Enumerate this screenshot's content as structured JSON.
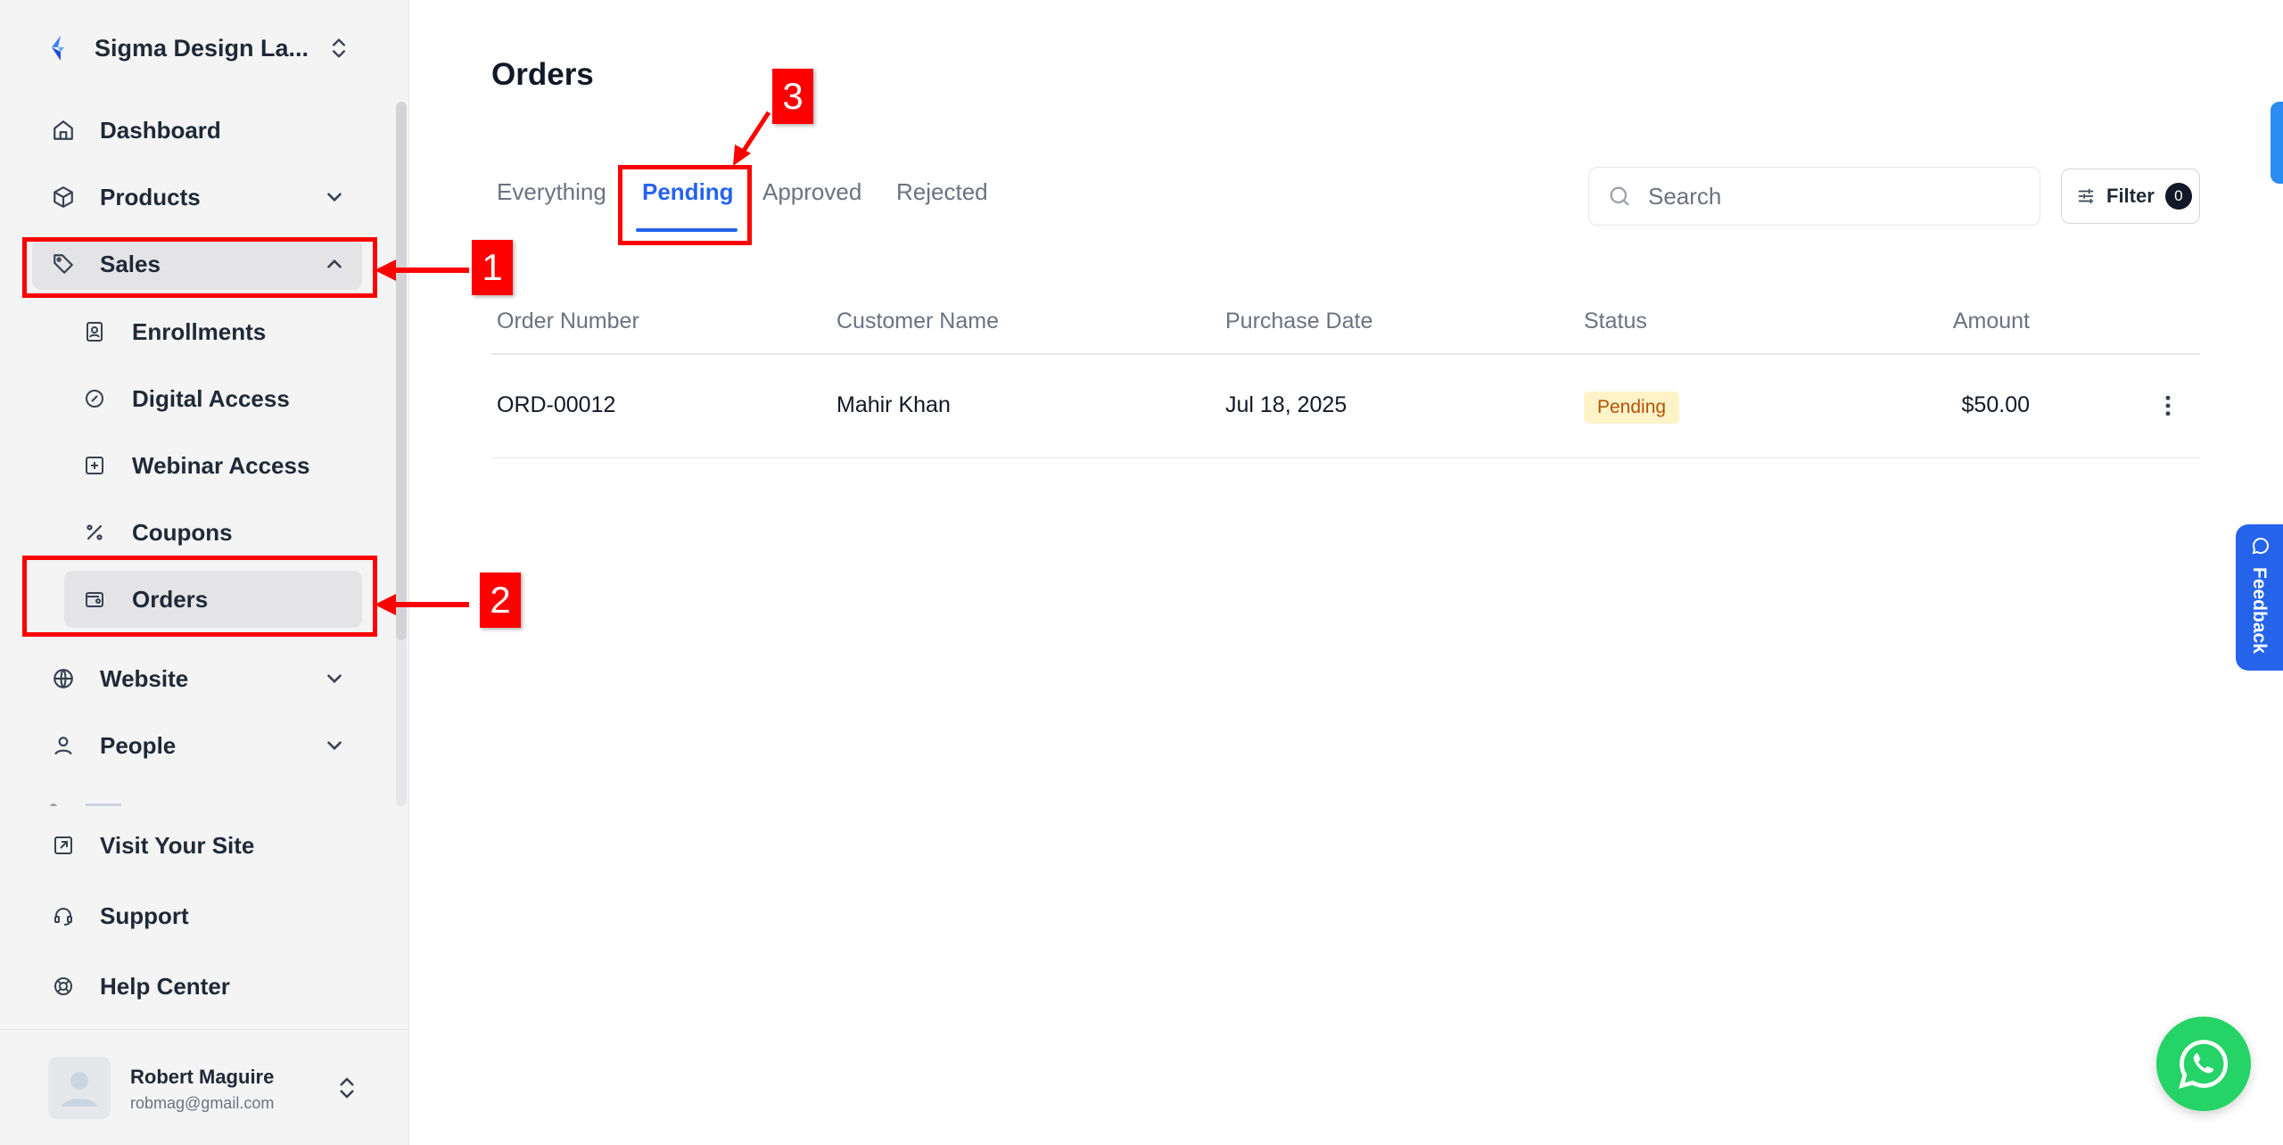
{
  "brand": {
    "name": "Sigma Design La..."
  },
  "nav": {
    "dashboard": "Dashboard",
    "products": "Products",
    "sales": "Sales",
    "sales_sub": {
      "enrollments": "Enrollments",
      "digital_access": "Digital Access",
      "webinar_access": "Webinar Access",
      "coupons": "Coupons",
      "orders": "Orders"
    },
    "website": "Website",
    "people": "People"
  },
  "bottom_links": {
    "visit_site": "Visit Your Site",
    "support": "Support",
    "help_center": "Help Center"
  },
  "user": {
    "name": "Robert Maguire",
    "email": "robmag@gmail.com"
  },
  "page": {
    "title": "Orders"
  },
  "tabs": {
    "everything": "Everything",
    "pending": "Pending",
    "approved": "Approved",
    "rejected": "Rejected",
    "active": "Pending"
  },
  "search": {
    "placeholder": "Search",
    "value": ""
  },
  "filter": {
    "label": "Filter",
    "count": "0"
  },
  "table": {
    "headers": {
      "order_number": "Order Number",
      "customer_name": "Customer Name",
      "purchase_date": "Purchase Date",
      "status": "Status",
      "amount": "Amount"
    },
    "rows": [
      {
        "order_number": "ORD-00012",
        "customer_name": "Mahir Khan",
        "purchase_date": "Jul 18, 2025",
        "status": "Pending",
        "amount": "$50.00"
      }
    ]
  },
  "feedback": {
    "label": "Feedback"
  },
  "annotations": {
    "one": "1",
    "two": "2",
    "three": "3"
  },
  "colors": {
    "accent": "#2563eb",
    "annotation": "#ff0000",
    "pending_bg": "#fef3c7",
    "pending_text": "#b45309",
    "whatsapp": "#25d366"
  }
}
